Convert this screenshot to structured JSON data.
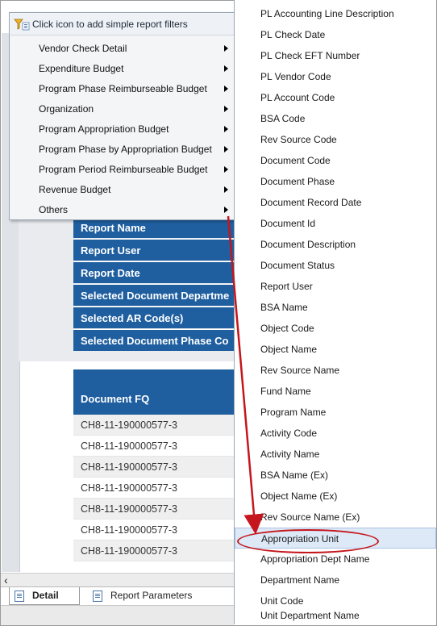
{
  "filter_menu": {
    "header": "Click icon to add simple report filters",
    "items": [
      {
        "label": "Vendor Check Detail"
      },
      {
        "label": "Expenditure Budget"
      },
      {
        "label": "Program Phase Reimburseable Budget"
      },
      {
        "label": "Organization"
      },
      {
        "label": "Program Appropriation Budget"
      },
      {
        "label": "Program Phase by Appropriation Budget"
      },
      {
        "label": "Program Period Reimburseable Budget"
      },
      {
        "label": "Revenue Budget"
      },
      {
        "label": "Others"
      }
    ]
  },
  "report": {
    "parameters": [
      "Report Name",
      "Report User",
      "Report Date",
      "Selected Document Departme",
      "Selected AR Code(s)",
      "Selected Document Phase Co"
    ],
    "table": {
      "header": "Document FQ",
      "rows": [
        "CH8-11-190000577-3",
        "CH8-11-190000577-3",
        "CH8-11-190000577-3",
        "CH8-11-190000577-3",
        "CH8-11-190000577-3",
        "CH8-11-190000577-3",
        "CH8-11-190000577-3"
      ]
    }
  },
  "column_list": {
    "items": [
      "PL Accounting Line Description",
      "PL Check Date",
      "PL Check EFT Number",
      "PL Vendor Code",
      "PL Account Code",
      "BSA Code",
      "Rev Source Code",
      "Document Code",
      "Document Phase",
      "Document Record Date",
      "Document Id",
      "Document Description",
      "Document Status",
      "Report User",
      "BSA Name",
      "Object Code",
      "Object Name",
      "Rev Source Name",
      "Fund Name",
      "Program Name",
      "Activity Code",
      "Activity Name",
      "BSA Name (Ex)",
      "Object Name (Ex)",
      "Rev Source Name (Ex)",
      "Appropriation Unit",
      "Appropriation Dept Name",
      "Department Name",
      "Unit Code",
      "Unit Department Name"
    ],
    "selected": "Appropriation Unit"
  },
  "tabs": [
    {
      "label": "Detail",
      "active": true
    },
    {
      "label": "Report Parameters",
      "active": false
    }
  ],
  "colors": {
    "accent": "#1f5fa0",
    "annotation": "#c4161c",
    "selection": "#dde9f7"
  }
}
